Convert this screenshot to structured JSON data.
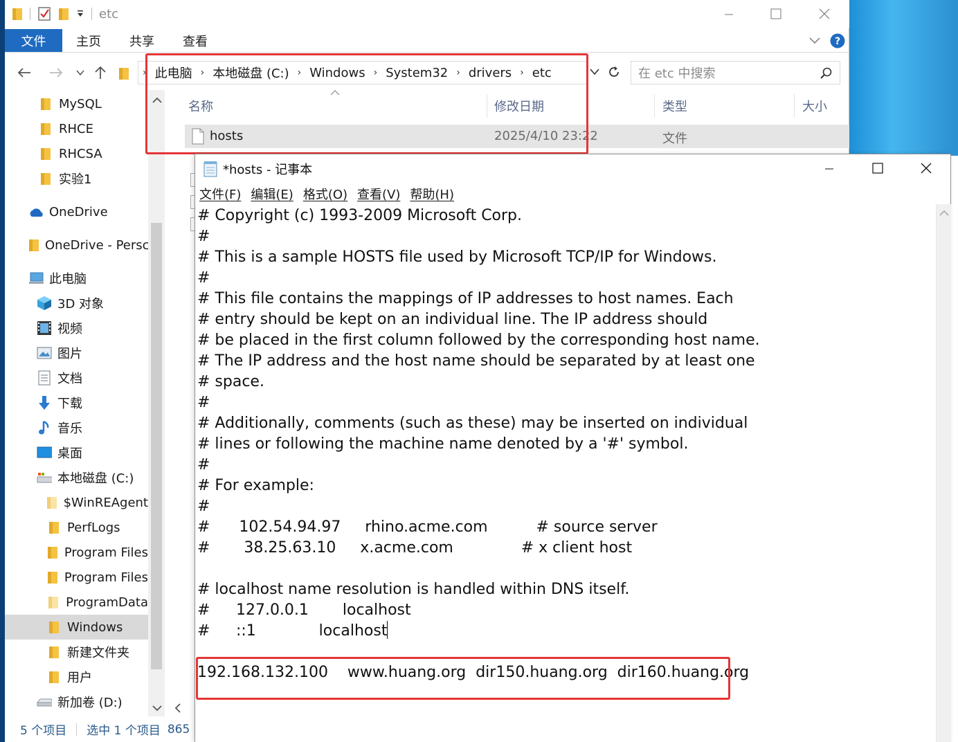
{
  "explorer": {
    "window_title": "etc",
    "ribbon_tabs": [
      "文件",
      "主页",
      "共享",
      "查看"
    ],
    "breadcrumb": [
      "此电脑",
      "本地磁盘 (C:)",
      "Windows",
      "System32",
      "drivers",
      "etc"
    ],
    "search_placeholder": "在 etc 中搜索",
    "columns": {
      "name": "名称",
      "date": "修改日期",
      "type": "类型",
      "size": "大小"
    },
    "file": {
      "name": "hosts",
      "date": "2025/4/10 23:22",
      "type": "文件"
    },
    "status": {
      "items": "5 个项目",
      "selected": "选中 1 个项目",
      "size": "865"
    },
    "nav": {
      "mysql": "MySQL",
      "rhce": "RHCE",
      "rhcsa": "RHCSA",
      "lab1": "实验1",
      "onedrive": "OneDrive",
      "onedrive_personal": "OneDrive - Persc",
      "this_pc": "此电脑",
      "objects3d": "3D 对象",
      "videos": "视频",
      "pictures": "图片",
      "documents": "文档",
      "downloads": "下载",
      "music": "音乐",
      "desktop": "桌面",
      "local_disk": "本地磁盘 (C:)",
      "winreagent": "$WinREAgent",
      "perflogs": "PerfLogs",
      "program_files": "Program Files",
      "program_files_x86": "Program Files",
      "programdata": "ProgramData",
      "windows": "Windows",
      "new_folder": "新建文件夹",
      "users": "用户",
      "new_volume": "新加卷 (D:)"
    }
  },
  "notepad": {
    "title": "*hosts - 记事本",
    "menu": [
      "文件(F)",
      "编辑(E)",
      "格式(O)",
      "查看(V)",
      "帮助(H)"
    ],
    "lines": [
      "# Copyright (c) 1993-2009 Microsoft Corp.",
      "#",
      "# This is a sample HOSTS file used by Microsoft TCP/IP for Windows.",
      "#",
      "# This file contains the mappings of IP addresses to host names. Each",
      "# entry should be kept on an individual line. The IP address should",
      "# be placed in the first column followed by the corresponding host name.",
      "# The IP address and the host name should be separated by at least one",
      "# space.",
      "#",
      "# Additionally, comments (such as these) may be inserted on individual",
      "# lines or following the machine name denoted by a '#' symbol.",
      "#",
      "# For example:",
      "#",
      "#      102.54.94.97     rhino.acme.com          # source server",
      "#       38.25.63.10     x.acme.com              # x client host",
      "",
      "# localhost name resolution is handled within DNS itself.",
      "#\t127.0.0.1       localhost",
      "#\t::1             localhost",
      "",
      "192.168.132.100    www.huang.org  dir150.huang.org  dir160.huang.org"
    ]
  },
  "colors": {
    "accent": "#1f6bc1",
    "highlight_box": "#e53535",
    "folder": "#f5c242"
  }
}
